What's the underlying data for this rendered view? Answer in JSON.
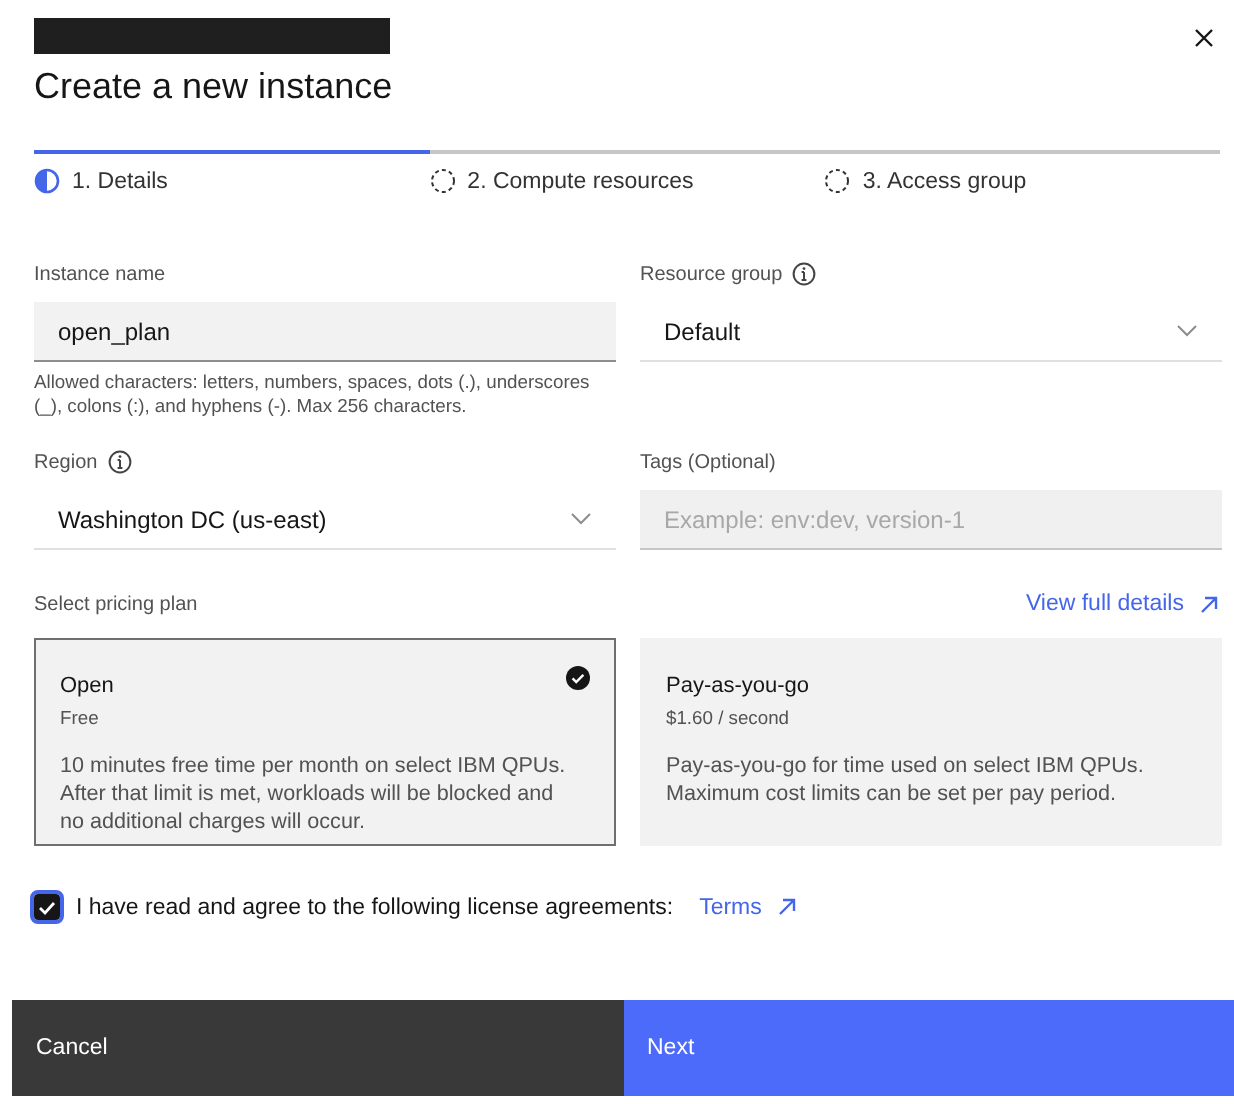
{
  "modal": {
    "title": "Create a new instance"
  },
  "steps": [
    {
      "label": "1. Details",
      "kind": "current"
    },
    {
      "label": "2. Compute resources",
      "kind": "incomplete"
    },
    {
      "label": "3. Access group",
      "kind": "incomplete"
    }
  ],
  "fields": [
    {
      "kind": "text",
      "label": "Instance name",
      "info": false,
      "value": "open_plan",
      "helper": "Allowed characters: letters, numbers, spaces, dots (.), underscores (_), colons (:), and hyphens (-). Max 256 characters."
    },
    {
      "kind": "select",
      "label": "Resource group",
      "info": true,
      "value": "Default"
    },
    {
      "kind": "select",
      "label": "Region",
      "info": true,
      "value": "Washington DC (us-east)"
    },
    {
      "kind": "text",
      "label": "Tags (Optional)",
      "info": false,
      "placeholder": "Example: env:dev, version-1"
    }
  ],
  "pricing": {
    "label": "Select pricing plan",
    "link": "View full details",
    "plans": [
      {
        "name": "Open",
        "price": "Free",
        "description": "10 minutes free time per month on select IBM QPUs. After that limit is met, workloads will be blocked and no additional charges will occur.",
        "selected": true
      },
      {
        "name": "Pay-as-you-go",
        "price": "$1.60 / second",
        "description": "Pay-as-you-go for time used on select IBM QPUs. Maximum cost limits can be set per pay period.",
        "selected": false
      }
    ]
  },
  "agreement": {
    "checked": true,
    "text": "I have read and agree to the following license agreements:",
    "link": "Terms"
  },
  "buttons": [
    {
      "label": "Cancel",
      "kind": "secondary"
    },
    {
      "label": "Next",
      "kind": "primary"
    }
  ]
}
